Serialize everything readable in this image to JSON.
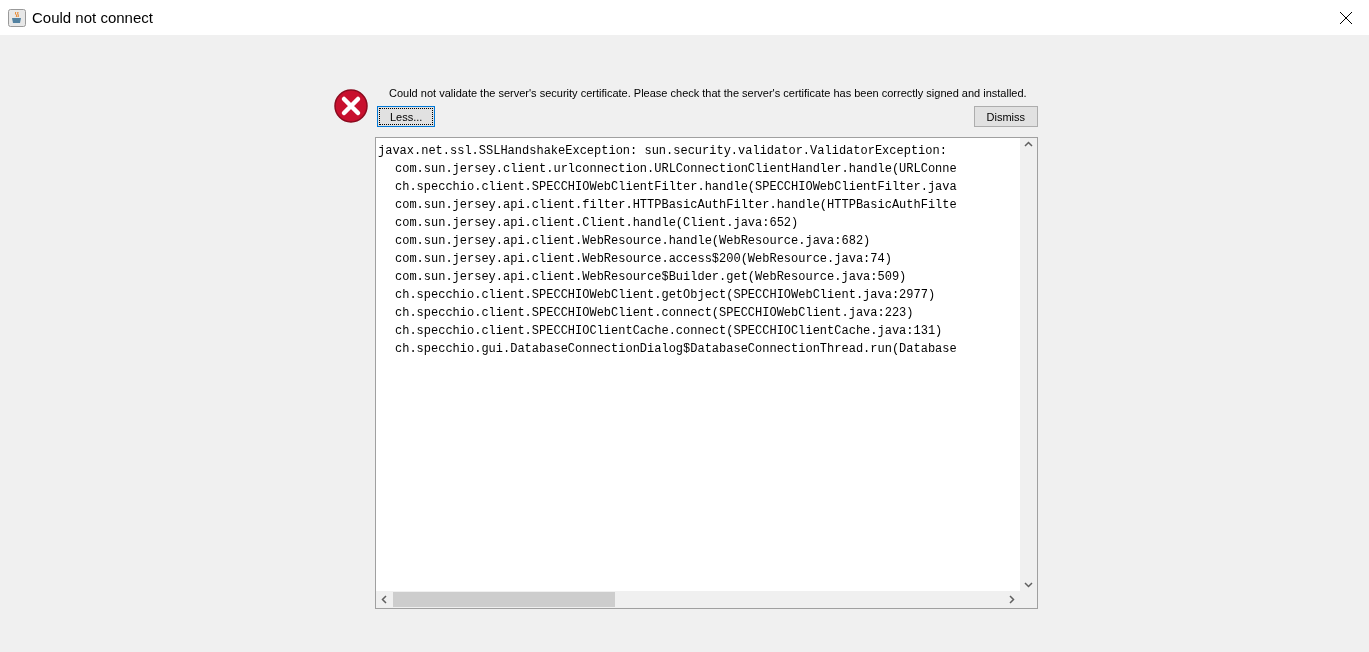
{
  "window": {
    "title": "Could not connect"
  },
  "message": "Could not validate the server's security certificate. Please check that the server's certificate has been correctly signed and installed.",
  "buttons": {
    "less": "Less...",
    "dismiss": "Dismiss"
  },
  "details": {
    "lines": [
      {
        "text": "javax.net.ssl.SSLHandshakeException: sun.security.validator.ValidatorException:",
        "indented": false
      },
      {
        "text": "com.sun.jersey.client.urlconnection.URLConnectionClientHandler.handle(URLConne",
        "indented": true
      },
      {
        "text": "ch.specchio.client.SPECCHIOWebClientFilter.handle(SPECCHIOWebClientFilter.java",
        "indented": true
      },
      {
        "text": "com.sun.jersey.api.client.filter.HTTPBasicAuthFilter.handle(HTTPBasicAuthFilte",
        "indented": true
      },
      {
        "text": "com.sun.jersey.api.client.Client.handle(Client.java:652)",
        "indented": true
      },
      {
        "text": "com.sun.jersey.api.client.WebResource.handle(WebResource.java:682)",
        "indented": true
      },
      {
        "text": "com.sun.jersey.api.client.WebResource.access$200(WebResource.java:74)",
        "indented": true
      },
      {
        "text": "com.sun.jersey.api.client.WebResource$Builder.get(WebResource.java:509)",
        "indented": true
      },
      {
        "text": "ch.specchio.client.SPECCHIOWebClient.getObject(SPECCHIOWebClient.java:2977)",
        "indented": true
      },
      {
        "text": "ch.specchio.client.SPECCHIOWebClient.connect(SPECCHIOWebClient.java:223)",
        "indented": true
      },
      {
        "text": "ch.specchio.client.SPECCHIOClientCache.connect(SPECCHIOClientCache.java:131)",
        "indented": true
      },
      {
        "text": "ch.specchio.gui.DatabaseConnectionDialog$DatabaseConnectionThread.run(Database",
        "indented": true
      }
    ]
  }
}
